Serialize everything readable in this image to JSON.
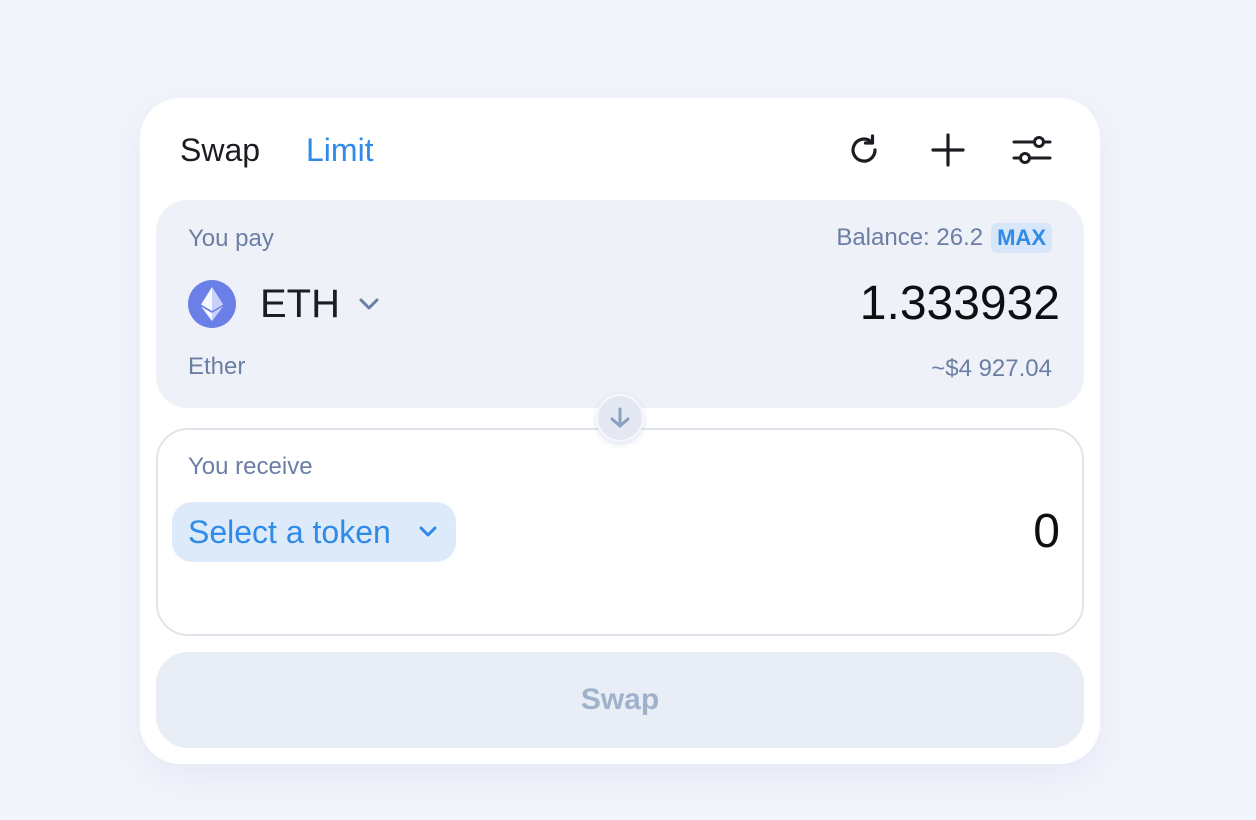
{
  "header": {
    "tabs": [
      {
        "label": "Swap",
        "active": true
      },
      {
        "label": "Limit",
        "active": false
      }
    ],
    "icons": [
      "refresh-icon",
      "plus-icon",
      "settings-sliders-icon"
    ]
  },
  "pay": {
    "label": "You pay",
    "balance_label": "Balance: 26.2",
    "max_label": "MAX",
    "token_symbol": "ETH",
    "token_name": "Ether",
    "amount": "1.333932",
    "usd_value": "~$4 927.04"
  },
  "receive": {
    "label": "You receive",
    "select_token_label": "Select a token",
    "amount": "0"
  },
  "action": {
    "swap_label": "Swap"
  },
  "colors": {
    "accent": "#2f8ae8",
    "eth_logo": "#6b7fe8",
    "muted_text": "#6b7ea3",
    "disabled_button": "#e8edf6"
  }
}
